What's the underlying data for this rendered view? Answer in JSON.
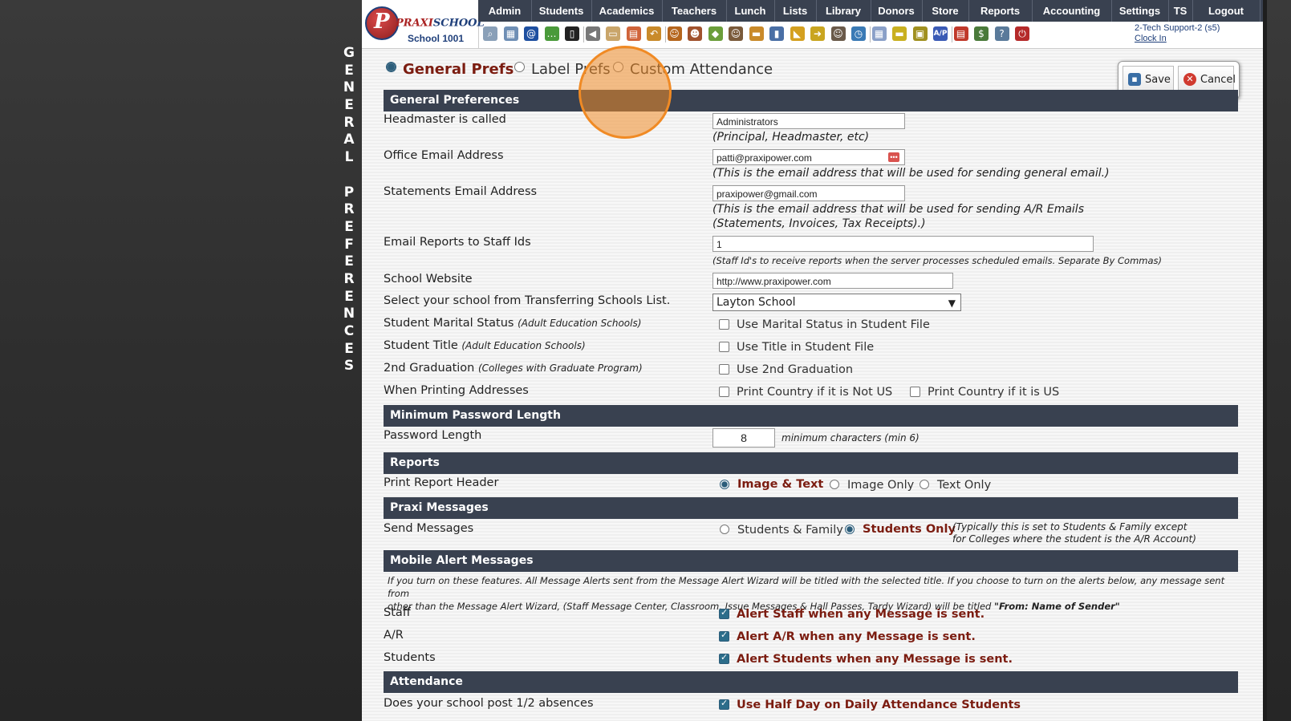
{
  "side_title_letters": [
    "G",
    "E",
    "N",
    "E",
    "R",
    "A",
    "L",
    "",
    "P",
    "R",
    "E",
    "F",
    "E",
    "R",
    "E",
    "N",
    "C",
    "E",
    "S"
  ],
  "logo": {
    "brand_a": "PRAXI",
    "brand_b": "SCHOOL",
    "tm": "™",
    "school": "School 1001",
    "initial": "P"
  },
  "nav": [
    "Admin",
    "Students",
    "Academics",
    "Teachers",
    "Lunch",
    "Lists",
    "Library",
    "Donors",
    "Store",
    "Reports",
    "Accounting",
    "Settings",
    "TS",
    "Logout"
  ],
  "toolbar_icons": [
    "search-icon",
    "grid-icon",
    "at-icon",
    "chat-icon",
    "phone-icon",
    "speaker-icon",
    "card-icon",
    "calendar-icon",
    "undo-icon",
    "person-icon",
    "teacher-icon",
    "ticket-icon",
    "group-icon",
    "lunch-icon",
    "book-icon",
    "megaphone-icon",
    "export-icon",
    "user-icon",
    "clock-icon",
    "table-icon",
    "id-card-icon",
    "cash-register-icon",
    "ap-icon",
    "pdf-icon",
    "money-icon",
    "help-icon",
    "power-icon"
  ],
  "toolbar_ap_label": "A/P",
  "user": {
    "name": "2-Tech Support-2 (s5)",
    "clock": "Clock In"
  },
  "tabs": [
    {
      "label": "General Prefs",
      "active": true
    },
    {
      "label": "Label Prefs",
      "active": false
    },
    {
      "label": "Custom Attendance",
      "active": false
    }
  ],
  "buttons": {
    "save": "Save",
    "cancel": "Cancel"
  },
  "sections": {
    "general": "General Preferences",
    "password": "Minimum Password Length",
    "reports": "Reports",
    "messages": "Praxi Messages",
    "mobile": "Mobile Alert Messages",
    "attendance": "Attendance"
  },
  "general": {
    "headmaster_label": "Headmaster is called",
    "headmaster_value": "Administrators",
    "headmaster_note": "(Principal, Headmaster, etc)",
    "office_email_label": "Office Email Address",
    "office_email_value": "patti@praxipower.com",
    "office_email_note": "(This is the email address that will be used for sending general email.)",
    "statements_label": "Statements Email Address",
    "statements_value": "praxipower@gmail.com",
    "statements_note_1": "(This is the email address that will be used for sending A/R Emails",
    "statements_note_2": "(Statements, Invoices, Tax Receipts).)",
    "email_reports_label": "Email Reports to Staff Ids",
    "email_reports_value": "1",
    "email_reports_note": "(Staff Id's to receive reports when the server processes scheduled emails. Separate By Commas)",
    "website_label": "School Website",
    "website_value": "http://www.praxipower.com",
    "transfer_label": "Select your school from Transferring Schools List.",
    "transfer_value": "Layton School",
    "marital_label": "Student Marital Status",
    "marital_hint": "(Adult Education Schools)",
    "marital_cb": "Use Marital Status in Student File",
    "title_label": "Student Title",
    "title_hint": "(Adult Education Schools)",
    "title_cb": "Use Title in Student File",
    "grad_label": "2nd Graduation",
    "grad_hint": "(Colleges with Graduate Program)",
    "grad_cb": "Use 2nd Graduation",
    "print_label": "When Printing Addresses",
    "print_cb1": "Print Country if it is Not US",
    "print_cb2": "Print Country if it is US"
  },
  "password": {
    "label": "Password Length",
    "value": "8",
    "note": "minimum characters (min 6)"
  },
  "reports": {
    "label": "Print Report Header",
    "options": [
      "Image & Text",
      "Image Only",
      "Text Only"
    ],
    "selected": "Image & Text"
  },
  "messages": {
    "label": "Send Messages",
    "options": [
      "Students & Family",
      "Students Only"
    ],
    "selected": "Students Only",
    "note_1": "(Typically this is set to Students & Family except",
    "note_2": "for Colleges where the student is the A/R Account)"
  },
  "mobile": {
    "desc_1": "If you turn on these features. All Message Alerts sent from the Message Alert Wizard will be titled with the selected title. If you choose to turn on the alerts below, any message sent from",
    "desc_2": "other than the Message Alert Wizard, (Staff Message Center, Classroom, Issue Messages & Hall Passes, Tardy Wizard) will be titled",
    "desc_3": "\"From: Name of Sender\"",
    "staff_label": "Staff",
    "staff_cb": "Alert Staff when any Message is sent.",
    "ar_label": "A/R",
    "ar_cb": "Alert A/R when any Message is sent.",
    "students_label": "Students",
    "students_cb": "Alert Students when any Message is sent."
  },
  "attendance": {
    "half_label": "Does your school post 1/2 absences",
    "half_cb": "Use Half Day on Daily Attendance Students"
  },
  "colors": {
    "nav_bg": "#394150",
    "accent_red": "#7b1c10",
    "highlight": "#f08a24"
  }
}
